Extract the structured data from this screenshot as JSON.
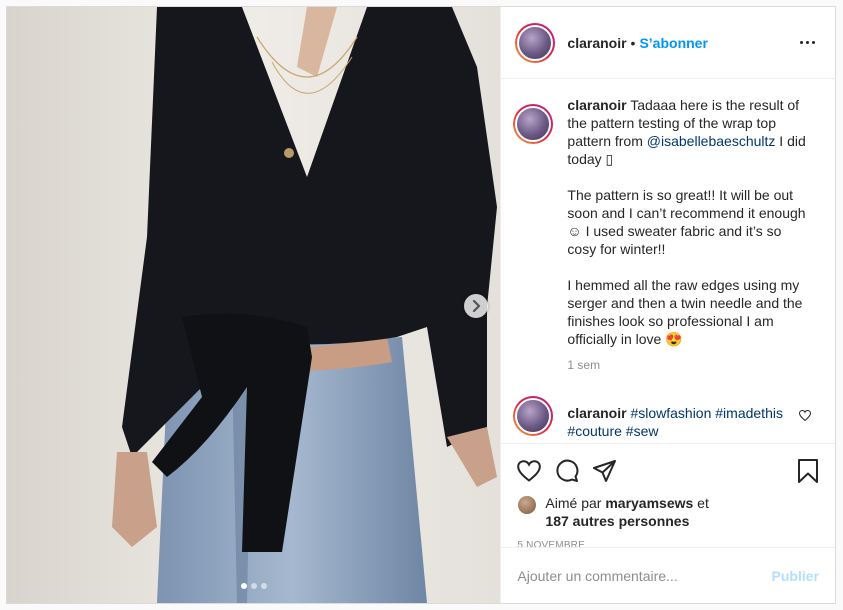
{
  "post": {
    "username": "claranoir",
    "follow_label": "S’abonner",
    "separator": "•"
  },
  "caption": {
    "username": "claranoir",
    "text_1": "Tadaaa here is the result of the pattern testing of the wrap top pattern from ",
    "mention": "@isabellebaeschultz",
    "text_2": " I did today ▯",
    "paragraph_2": "The pattern is so great!! It will be out soon and I can’t recommend it enough ☺ I used sweater fabric and it’s so cosy for winter!!",
    "paragraph_3": "I hemmed all the raw edges using my serger and then a twin needle and the finishes look so professional I am officially in love 😍",
    "time": "1 sem"
  },
  "comment2": {
    "username": "claranoir",
    "tag_1": "#slowfashion",
    "tag_2": "#imadethis #couture #sew"
  },
  "likes": {
    "prefix": "Aimé par",
    "user": "maryamsews",
    "and": "et",
    "others": "187 autres personnes"
  },
  "date": "5 NOVEMBRE",
  "add_comment": {
    "placeholder": "Ajouter un commentaire...",
    "publish_label": "Publier"
  },
  "carousel": {
    "total": 3,
    "active": 0
  },
  "colors": {
    "accent": "#0095f6",
    "link": "#00376b",
    "publish_disabled": "#b2dffc"
  }
}
